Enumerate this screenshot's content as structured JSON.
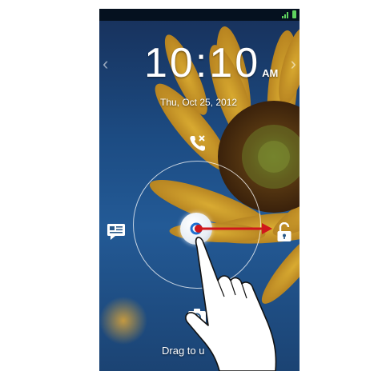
{
  "lockscreen": {
    "time": "10:10",
    "ampm": "AM",
    "date": "Thu, Oct 25, 2012",
    "hint": "Drag to u"
  },
  "nav": {
    "left_glyph": "‹",
    "right_glyph": "›"
  },
  "targets": {
    "phone": "phone-missed-call-icon",
    "message": "message-icon",
    "unlock": "unlock-icon",
    "camera": "camera-icon"
  },
  "colors": {
    "arrow": "#d0161b",
    "ring": "#ffffff",
    "battery": "#5fd35f"
  }
}
